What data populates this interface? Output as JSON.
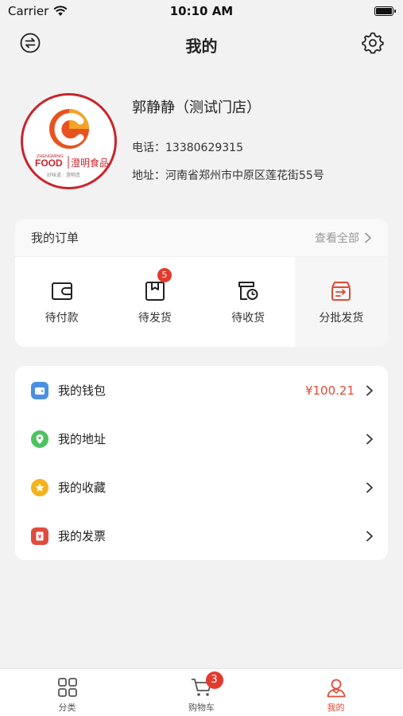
{
  "status_bar": {
    "carrier": "Carrier",
    "time": "10:10 AM"
  },
  "nav": {
    "title": "我的",
    "left_icon": "swap-icon",
    "right_icon": "gear-icon"
  },
  "profile": {
    "name": "郭静静（测试门店）",
    "phone": "电话：13380629315",
    "address": "地址：河南省郑州市中原区莲花街55号",
    "logo": {
      "brand_cn": "澄明食品",
      "brand_en": "FOOD",
      "brand_small": "ZHENGMING",
      "slogan": "好味道 · 澄明造"
    }
  },
  "orders": {
    "title": "我的订单",
    "view_all": "查看全部",
    "items": [
      {
        "label": "待付款",
        "icon": "wallet-icon",
        "badge": ""
      },
      {
        "label": "待发货",
        "icon": "package-icon",
        "badge": "5"
      },
      {
        "label": "待收货",
        "icon": "delivery-clock-icon",
        "badge": ""
      },
      {
        "label": "分批发货",
        "icon": "batch-shipping-icon",
        "badge": ""
      }
    ]
  },
  "menu": [
    {
      "label": "我的钱包",
      "value": "¥100.21",
      "icon": "wallet-icon",
      "color": "#4a90e2"
    },
    {
      "label": "我的地址",
      "value": "",
      "icon": "location-pin-icon",
      "color": "#4cc260"
    },
    {
      "label": "我的收藏",
      "value": "",
      "icon": "star-icon",
      "color": "#f5b21c"
    },
    {
      "label": "我的发票",
      "value": "",
      "icon": "invoice-icon",
      "color": "#e14b3d"
    }
  ],
  "tabs": [
    {
      "label": "分类",
      "icon": "grid-icon",
      "badge": "",
      "active": false
    },
    {
      "label": "购物车",
      "icon": "cart-icon",
      "badge": "3",
      "active": false
    },
    {
      "label": "我的",
      "icon": "user-icon",
      "badge": "",
      "active": true
    }
  ],
  "colors": {
    "accent": "#e04a36",
    "badge": "#e23b2e",
    "logo_red": "#c8252c",
    "logo_orange": "#f08a1e"
  }
}
